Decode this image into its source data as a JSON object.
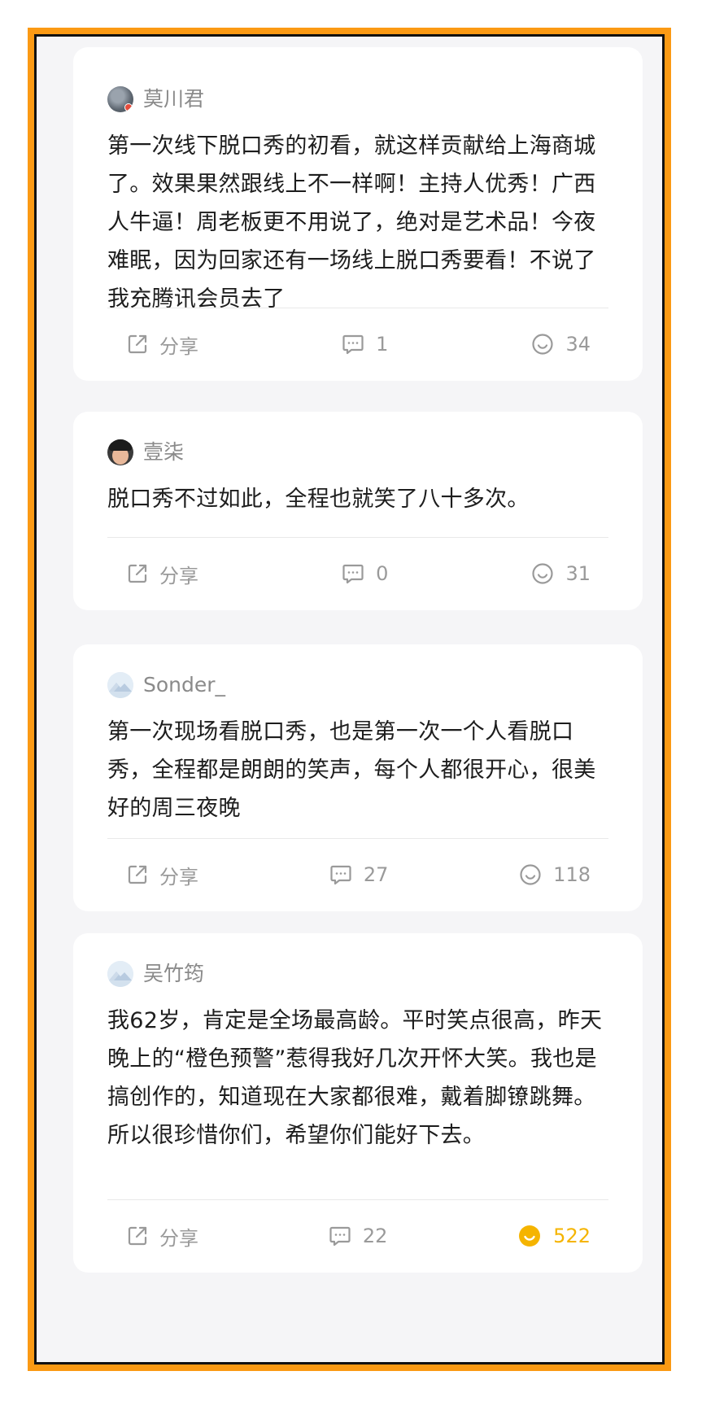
{
  "colors": {
    "frame_orange": "#fb9a14",
    "liked_yellow": "#f5b400",
    "muted_text": "#9a9a9a"
  },
  "posts": [
    {
      "username": "莫川君",
      "avatar_icon": "user-avatar-photo",
      "text": "第一次线下脱口秀的初看，就这样贡献给上海商城了。效果果然跟线上不一样啊！主持人优秀！广西人牛逼！周老板更不用说了，绝对是艺术品！今夜难眠，因为回家还有一场线上脱口秀要看！不说了我充腾讯会员去了",
      "share_label": "分享",
      "comment_count": "1",
      "like_count": "34",
      "liked": false
    },
    {
      "username": "壹柒",
      "avatar_icon": "user-avatar-photo",
      "text": "脱口秀不过如此，全程也就笑了八十多次。",
      "share_label": "分享",
      "comment_count": "0",
      "like_count": "31",
      "liked": false
    },
    {
      "username": "Sonder_",
      "avatar_icon": "default-mountain-avatar",
      "text": "第一次现场看脱口秀，也是第一次一个人看脱口秀，全程都是朗朗的笑声，每个人都很开心，很美好的周三夜晚",
      "share_label": "分享",
      "comment_count": "27",
      "like_count": "118",
      "liked": false
    },
    {
      "username": "吴竹筠",
      "avatar_icon": "default-mountain-avatar",
      "text": "我62岁，肯定是全场最高龄。平时笑点很高，昨天晚上的“橙色预警”惹得我好几次开怀大笑。我也是搞创作的，知道现在大家都很难，戴着脚镣跳舞。所以很珍惜你们，希望你们能好下去。",
      "share_label": "分享",
      "comment_count": "22",
      "like_count": "522",
      "liked": true
    }
  ]
}
